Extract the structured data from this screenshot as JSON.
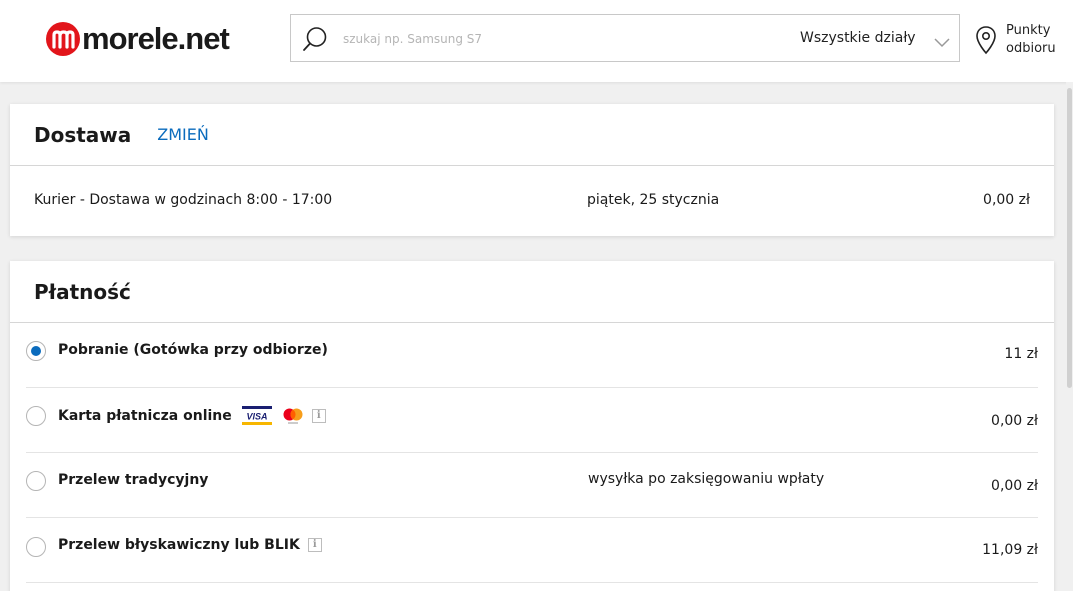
{
  "header": {
    "logo_text": "morele.net",
    "search_placeholder": "szukaj np. Samsung S7",
    "department": "Wszystkie działy",
    "pickup_line1": "Punkty",
    "pickup_line2": "odbioru"
  },
  "delivery": {
    "title": "Dostawa",
    "change_label": "ZMIEŃ",
    "method": "Kurier - Dostawa w godzinach 8:00 - 17:00",
    "date": "piątek, 25 stycznia",
    "price": "0,00 zł"
  },
  "payment": {
    "title": "Płatność",
    "options": [
      {
        "label": "Pobranie (Gotówka przy odbiorze)",
        "note": "",
        "price": "11 zł",
        "selected": true
      },
      {
        "label": "Karta płatnicza online",
        "note": "",
        "price": "0,00 zł",
        "selected": false,
        "icons": [
          "visa-icon",
          "mastercard-icon",
          "info-icon"
        ]
      },
      {
        "label": "Przelew tradycyjny",
        "note": "wysyłka po zaksięgowaniu wpłaty",
        "price": "0,00 zł",
        "selected": false
      },
      {
        "label": "Przelew błyskawiczny lub BLIK",
        "note": "",
        "price": "11,09 zł",
        "selected": false,
        "icons": [
          "info-icon"
        ]
      }
    ]
  },
  "colors": {
    "brand_red": "#e2151b",
    "link_blue": "#0a6bbd",
    "page_bg": "#f0f0f0"
  }
}
